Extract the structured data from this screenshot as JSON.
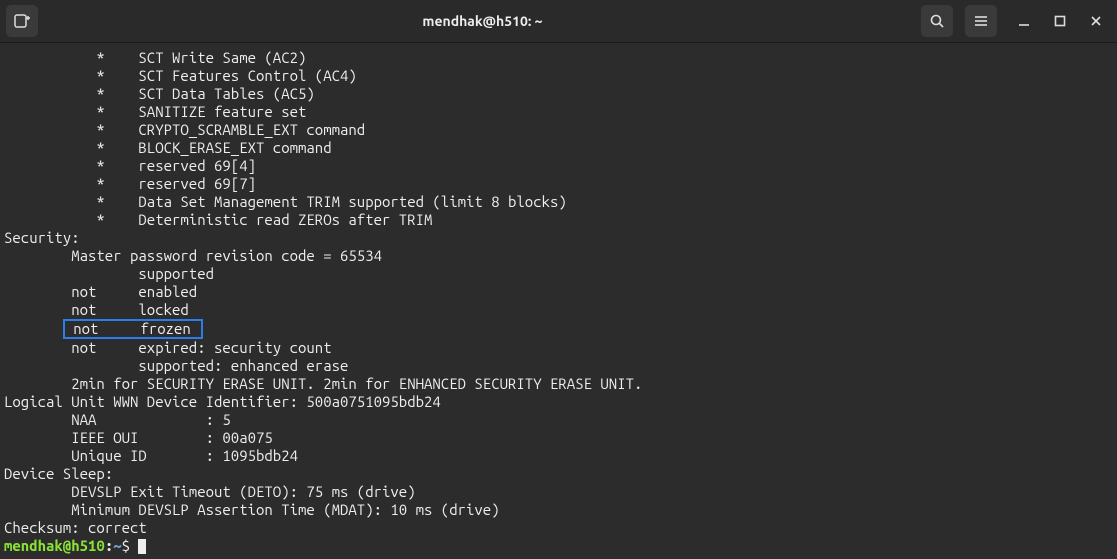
{
  "window": {
    "title": "mendhak@h510: ~"
  },
  "terminal": {
    "lines": [
      "           *    SCT Write Same (AC2)",
      "           *    SCT Features Control (AC4)",
      "           *    SCT Data Tables (AC5)",
      "           *    SANITIZE feature set",
      "           *    CRYPTO_SCRAMBLE_EXT command",
      "           *    BLOCK_ERASE_EXT command",
      "           *    reserved 69[4]",
      "           *    reserved 69[7]",
      "           *    Data Set Management TRIM supported (limit 8 blocks)",
      "           *    Deterministic read ZEROs after TRIM",
      "Security: ",
      "        Master password revision code = 65534",
      "                supported",
      "        not     enabled",
      "        not     locked",
      "        not     frozen",
      "        not     expired: security count",
      "                supported: enhanced erase",
      "        2min for SECURITY ERASE UNIT. 2min for ENHANCED SECURITY ERASE UNIT.",
      "Logical Unit WWN Device Identifier: 500a0751095bdb24",
      "        NAA             : 5",
      "        IEEE OUI        : 00a075",
      "        Unique ID       : 1095bdb24",
      "Device Sleep:",
      "        DEVSLP Exit Timeout (DETO): 75 ms (drive)",
      "        Minimum DEVSLP Assertion Time (MDAT): 10 ms (drive)",
      "Checksum: correct"
    ],
    "highlight_line_index": 15,
    "highlight_prefix": "       ",
    "highlight_content": " not     frozen ",
    "prompt": {
      "user_host": "mendhak@h510",
      "path": "~",
      "symbol": "$"
    }
  }
}
